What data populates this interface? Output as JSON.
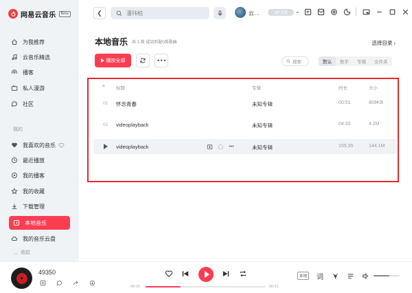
{
  "app": {
    "name": "网易云音乐",
    "beta": "Beta"
  },
  "sidebar": {
    "items": [
      {
        "label": "为我推荐"
      },
      {
        "label": "云音乐精选"
      },
      {
        "label": "播客"
      },
      {
        "label": "私人漫游"
      },
      {
        "label": "社区"
      }
    ],
    "section_mine": "我的",
    "mine_items": [
      {
        "label": "我喜欢的音乐"
      },
      {
        "label": "最近播放"
      },
      {
        "label": "我的播客"
      },
      {
        "label": "我的收藏"
      },
      {
        "label": "下载管理"
      },
      {
        "label": "本地音乐"
      },
      {
        "label": "我的音乐云盘"
      }
    ],
    "collapse": "收起"
  },
  "topbar": {
    "search_placeholder": "潘玮柏",
    "username": "云…",
    "vip": "VIP 开通"
  },
  "main": {
    "title": "本地音乐",
    "subtitle": "共 3 首 成功匹配0首歌曲",
    "select_dir": "选择目录",
    "play_all": "播放全部",
    "search_placeholder": "搜索",
    "sort_tabs": [
      "默认",
      "歌手",
      "专辑",
      "文件夹"
    ],
    "columns": {
      "num": "#",
      "title": "标题",
      "album": "专辑",
      "duration": "时长",
      "size": "大小"
    },
    "rows": [
      {
        "num": "01",
        "title": "怀念青春",
        "album": "未知专辑",
        "duration": "00:51",
        "size": "809KB"
      },
      {
        "num": "02",
        "title": "videoplayback",
        "album": "未知专辑",
        "duration": "04:32",
        "size": "4.2M"
      },
      {
        "num": "",
        "title": "videoplayback",
        "album": "未知专辑",
        "duration": "155:35",
        "size": "144.1M"
      }
    ]
  },
  "player": {
    "now_playing": "49350",
    "time_current": "00:15",
    "time_total": "00:51",
    "progress": 0.29,
    "quality": "本地",
    "lyrics_icon": "词",
    "volume": 0.6
  },
  "colors": {
    "accent": "#fb3d52",
    "frame": "#e8262b",
    "sidebar_bg": "#f0f3f6"
  }
}
